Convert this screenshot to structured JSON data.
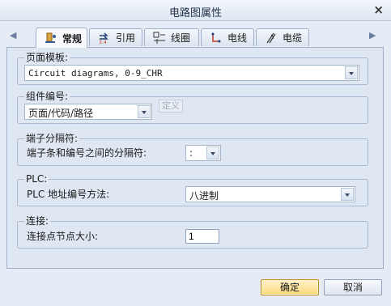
{
  "window": {
    "title": "电路图属性",
    "close_icon": "close-icon"
  },
  "tabs": [
    {
      "label": "常规",
      "icon": "settings-icon",
      "active": true
    },
    {
      "label": "引用",
      "icon": "reference-icon",
      "active": false
    },
    {
      "label": "线圈",
      "icon": "coil-icon",
      "active": false
    },
    {
      "label": "电线",
      "icon": "wire-icon",
      "active": false
    },
    {
      "label": "电缆",
      "icon": "cable-icon",
      "active": false
    }
  ],
  "page_template": {
    "legend": "页面模板:",
    "value": "Circuit diagrams, 0-9_CHR"
  },
  "component_numbering": {
    "legend": "组件编号:",
    "value": "页面/代码/路径",
    "define_label": "定义"
  },
  "terminal_separator": {
    "legend": "端子分隔符:",
    "field_label": "端子条和编号之间的分隔符:",
    "value": ":"
  },
  "plc": {
    "legend": "PLC:",
    "field_label": "PLC 地址编号方法:",
    "value": "八进制"
  },
  "connection": {
    "legend": "连接:",
    "field_label": "连接点节点大小:",
    "value": "1"
  },
  "buttons": {
    "ok": "确定",
    "cancel": "取消"
  },
  "colors": {
    "default_button": "#fcd97b",
    "panel": "#dfe7f2"
  }
}
